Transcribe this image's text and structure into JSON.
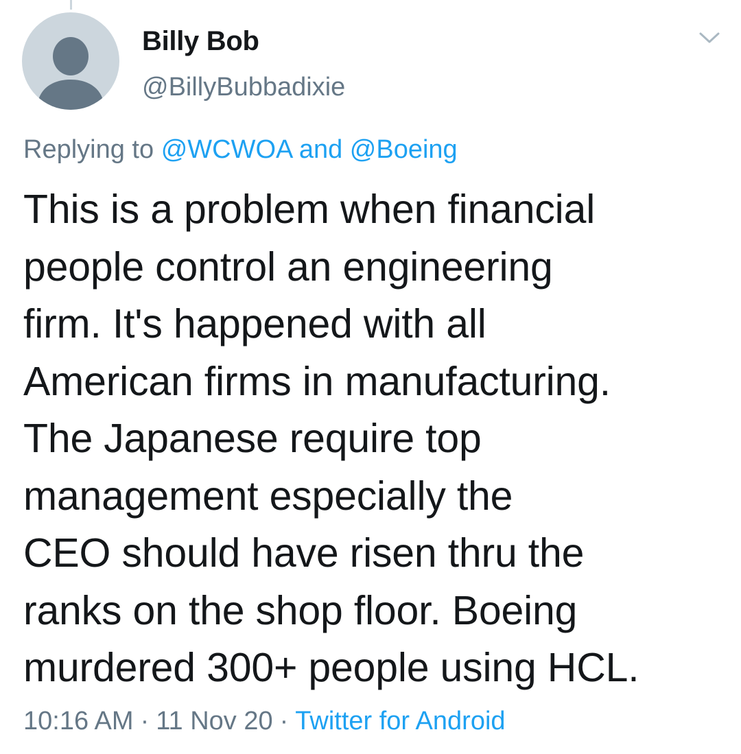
{
  "tweet": {
    "author": {
      "display_name": "Billy Bob",
      "handle": "@BillyBubbadixie",
      "avatar_icon": "default-profile-silhouette-icon"
    },
    "menu_icon": "chevron-down-icon",
    "replying": {
      "prefix": "Replying to",
      "mention_1": "@WCWOA",
      "conjunction": "and",
      "mention_2": "@Boeing"
    },
    "text_lines": [
      "This is a problem when financial",
      "people control an engineering",
      "firm. It's happened with all",
      "American firms in manufacturing.",
      "The Japanese require top",
      "management especially the",
      "CEO should have risen thru the",
      "ranks on the shop floor. Boeing",
      "murdered 300+ people using HCL."
    ],
    "meta": {
      "time": "10:16 AM",
      "date": "11 Nov 20",
      "separator": "·",
      "source": "Twitter for Android"
    }
  },
  "colors": {
    "text": "#14171a",
    "secondary": "#657786",
    "link": "#1da1f2",
    "avatar_bg": "#ccd6dd",
    "avatar_figure": "#657786"
  }
}
